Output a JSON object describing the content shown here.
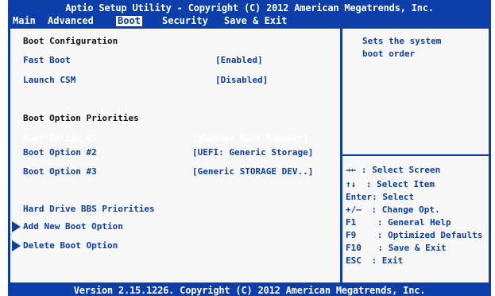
{
  "header": {
    "title": "Aptio Setup Utility - Copyright (C) 2012 American Megatrends, Inc.",
    "tabs": [
      "Main",
      "Advanced",
      "Boot",
      "Security",
      "Save & Exit"
    ],
    "active_tab": "Boot"
  },
  "boot": {
    "boot_configuration": "Boot Configuration",
    "fast_boot": {
      "label": "Fast Boot",
      "value": "[Enabled]"
    },
    "launch_csm": {
      "label": "Launch CSM",
      "value": "[Disabled]"
    },
    "boot_option_priorities": "Boot Option Priorities",
    "options": [
      {
        "label": "Boot Option #1",
        "value": "[Windows Boot Manager]"
      },
      {
        "label": "Boot Option #2",
        "value": "[UEFI: Generic Storage]"
      },
      {
        "label": "Boot Option #3",
        "value": "[Generic STORAGE DEV..]"
      }
    ],
    "selected_option_index": 0,
    "hard_drive_bbs": "Hard Drive BBS Priorities",
    "add_new_boot_option": "Add New Boot Option",
    "delete_boot_option": "Delete Boot Option"
  },
  "help_panel": {
    "description_line1": "Sets the system",
    "description_line2": "boot order",
    "keys": [
      {
        "key": "→←",
        "action": ": Select Screen"
      },
      {
        "key": "↑↓",
        "action": ": Select Item"
      },
      {
        "key": "Enter:",
        "action": "Select"
      },
      {
        "key": "+/—",
        "action": ": Change Opt."
      },
      {
        "key": "F1",
        "action": ": General Help"
      },
      {
        "key": "F9",
        "action": ": Optimized Defaults"
      },
      {
        "key": "F10",
        "action": ": Save & Exit"
      },
      {
        "key": "ESC",
        "action": ": Exit"
      }
    ]
  },
  "footer": {
    "version": "Version 2.15.1226. Copyright (C) 2012 American Megatrends, Inc."
  },
  "colors": {
    "bios_blue": "#0c3fa9",
    "panel_bg": "#f7f7f7",
    "selected_text": "#ffffff"
  }
}
